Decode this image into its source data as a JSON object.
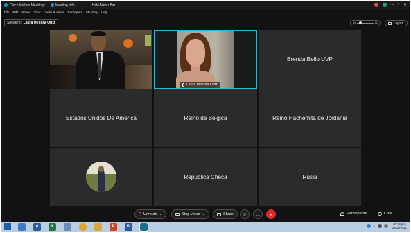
{
  "titlebar": {
    "app_title": "Cisco Webex Meetings",
    "meeting_info": "Meeting Info",
    "hide_menu": "Hide Menu Bar",
    "hide_menu_icon": "chevron-up-icon"
  },
  "menubar": {
    "items": [
      "File",
      "Edit",
      "Share",
      "View",
      "Audio & Video",
      "Participant",
      "Meeting",
      "Help"
    ]
  },
  "speaking": {
    "label": "Speaking:",
    "name": "Laura Melissa Ortiz"
  },
  "layout_button": {
    "label": "Layout"
  },
  "tiles": {
    "t2_caption": "Laura Melissa Ortiz",
    "t3": "Brenda Bello UVP",
    "t4": "Estados Unidos De America",
    "t5": "Reino de Bélgica",
    "t6": "Reino Hachemita de Jordania",
    "t8": "República Checa",
    "t9": "Rusia"
  },
  "controls": {
    "mute": "Unmute",
    "video": "Stop video",
    "share": "Share",
    "more": "...",
    "end": "×",
    "participants": "Participants",
    "chat": "Chat"
  },
  "taskbar": {
    "time": "02:18 p.m.",
    "date": "28/10/2021"
  },
  "colors": {
    "active_border": "#2ab7d6",
    "end_button": "#e02b2b",
    "taskbar": "#b9cde4"
  }
}
